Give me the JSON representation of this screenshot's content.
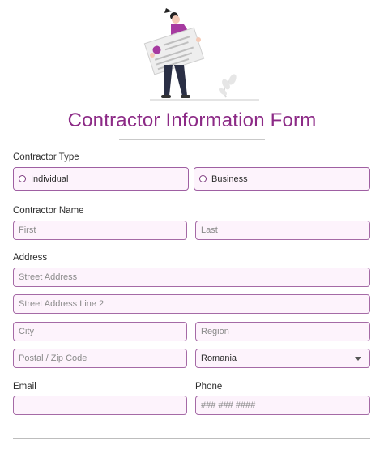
{
  "form": {
    "title": "Contractor Information Form"
  },
  "contractor_type": {
    "label": "Contractor Type",
    "options": [
      "Individual",
      "Business"
    ]
  },
  "contractor_name": {
    "label": "Contractor Name",
    "first_placeholder": "First",
    "last_placeholder": "Last"
  },
  "address": {
    "label": "Address",
    "street_placeholder": "Street Address",
    "street2_placeholder": "Street Address Line 2",
    "city_placeholder": "City",
    "region_placeholder": "Region",
    "postal_placeholder": "Postal / Zip Code",
    "country_value": "Romania"
  },
  "email": {
    "label": "Email",
    "value": ""
  },
  "phone": {
    "label": "Phone",
    "placeholder": "### ### ####"
  },
  "colors": {
    "accent": "#8c2a86",
    "field_bg": "#fdf3fc",
    "field_border": "#a56aa6"
  }
}
